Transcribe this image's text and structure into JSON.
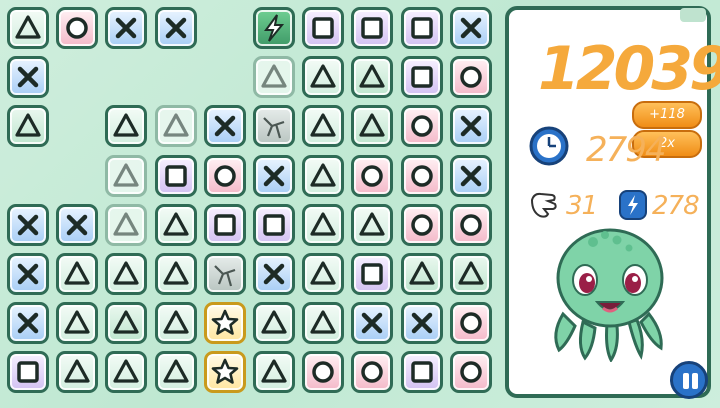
{
  "score": "12039",
  "bonus_points": "+118",
  "multiplier": "2x",
  "timer_value": "2794",
  "moves_value": "31",
  "bolts_value": "278",
  "icons": {
    "timer": "clock-icon",
    "moves": "glove-icon",
    "bolts": "lightning-badge-icon",
    "pause": "pause-icon",
    "mascot": "octopus-mascot"
  },
  "colors": {
    "accent": "#f5a93c",
    "frame": "#2f6b55",
    "pause": "#2a72c8"
  },
  "board": {
    "columns": 10,
    "tiles": [
      [
        "tri",
        0,
        0
      ],
      [
        "ring",
        1,
        0
      ],
      [
        "cross",
        2,
        0
      ],
      [
        "cross",
        3,
        0
      ],
      [
        "bolt",
        5,
        0
      ],
      [
        "sq",
        6,
        0
      ],
      [
        "sq",
        7,
        0
      ],
      [
        "sq",
        8,
        0
      ],
      [
        "cross",
        9,
        0
      ],
      [
        "cross",
        0,
        1
      ],
      [
        "ghost-tri",
        5,
        1
      ],
      [
        "tri",
        6,
        1
      ],
      [
        "trig",
        7,
        1
      ],
      [
        "sq",
        8,
        1
      ],
      [
        "ring",
        9,
        1
      ],
      [
        "trig",
        0,
        2
      ],
      [
        "tri",
        2,
        2
      ],
      [
        "ghost-tri",
        3,
        2
      ],
      [
        "cross",
        4,
        2
      ],
      [
        "rock",
        5,
        2
      ],
      [
        "tri",
        6,
        2
      ],
      [
        "trig",
        7,
        2
      ],
      [
        "ring",
        8,
        2
      ],
      [
        "cross",
        9,
        2
      ],
      [
        "ghost-tri",
        2,
        3
      ],
      [
        "sq",
        3,
        3
      ],
      [
        "ring",
        4,
        3
      ],
      [
        "cross",
        5,
        3
      ],
      [
        "tri",
        6,
        3
      ],
      [
        "ring",
        7,
        3
      ],
      [
        "ring",
        8,
        3
      ],
      [
        "cross",
        9,
        3
      ],
      [
        "cross",
        0,
        4
      ],
      [
        "cross",
        1,
        4
      ],
      [
        "ghost-tri",
        2,
        4
      ],
      [
        "tri",
        3,
        4
      ],
      [
        "sq",
        4,
        4
      ],
      [
        "sq",
        5,
        4
      ],
      [
        "tri",
        6,
        4
      ],
      [
        "tri",
        7,
        4
      ],
      [
        "ring",
        8,
        4
      ],
      [
        "ring",
        9,
        4
      ],
      [
        "cross",
        0,
        5
      ],
      [
        "tri",
        1,
        5
      ],
      [
        "tri",
        2,
        5
      ],
      [
        "tri",
        3,
        5
      ],
      [
        "rock",
        4,
        5
      ],
      [
        "cross",
        5,
        5
      ],
      [
        "tri",
        6,
        5
      ],
      [
        "sq",
        7,
        5
      ],
      [
        "trig",
        8,
        5
      ],
      [
        "trig",
        9,
        5
      ],
      [
        "cross",
        0,
        6
      ],
      [
        "tri",
        1,
        6
      ],
      [
        "trig",
        2,
        6
      ],
      [
        "tri",
        3,
        6
      ],
      [
        "star",
        4,
        6
      ],
      [
        "tri",
        5,
        6
      ],
      [
        "tri",
        6,
        6
      ],
      [
        "cross",
        7,
        6
      ],
      [
        "cross",
        8,
        6
      ],
      [
        "ring",
        9,
        6
      ],
      [
        "sq",
        0,
        7
      ],
      [
        "tri",
        1,
        7
      ],
      [
        "tri",
        2,
        7
      ],
      [
        "tri",
        3,
        7
      ],
      [
        "star",
        4,
        7
      ],
      [
        "tri",
        5,
        7
      ],
      [
        "ring",
        6,
        7
      ],
      [
        "ring",
        7,
        7
      ],
      [
        "sq",
        8,
        7
      ],
      [
        "ring",
        9,
        7
      ]
    ]
  }
}
